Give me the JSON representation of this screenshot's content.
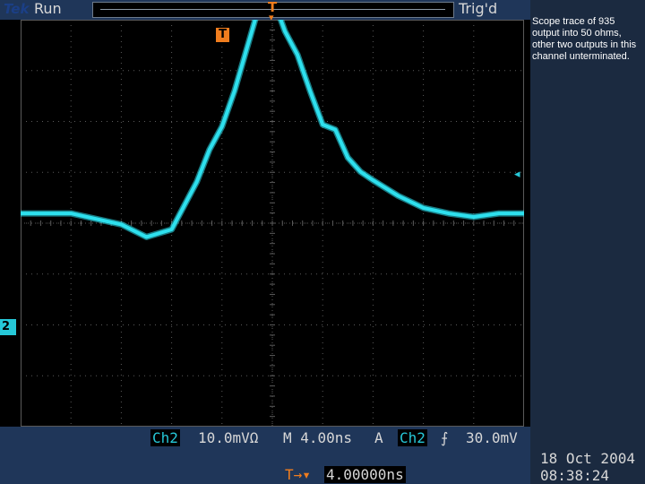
{
  "header": {
    "brand": "Tek",
    "run_status": "Run",
    "trigger_status": "Trig'd"
  },
  "markers": {
    "trigger_position": "T",
    "trigger_on_screen": "T",
    "channel_ground": "2",
    "trigger_level": "◂"
  },
  "status": {
    "channel": "Ch2",
    "volts_per_div": "10.0mVΩ",
    "timebase": "M 4.00ns",
    "trigger_mode": "A",
    "trigger_channel": "Ch2",
    "trigger_slope_icon": "rising-edge-icon",
    "trigger_level": "30.0mV",
    "trigger_delay_label": "T→▾",
    "trigger_delay": "4.00000ns",
    "date": "18 Oct  2004",
    "time": "08:38:24"
  },
  "annotation": "Scope trace of 935 output into 50 ohms, other two outputs in this channel unterminated.",
  "colors": {
    "trace": "#2ee0ee",
    "trigger_marker": "#f07d1e",
    "graticule": "#5a5a5a",
    "panel": "#1f3659"
  },
  "chart_data": {
    "type": "line",
    "title": "",
    "xlabel": "",
    "ylabel": "",
    "x_units": "ns",
    "y_units": "mV",
    "x": [
      -20,
      -16,
      -12,
      -10,
      -8,
      -6,
      -5,
      -4,
      -3,
      -2,
      -1,
      0,
      1,
      2,
      3,
      4,
      5,
      6,
      7,
      8,
      10,
      12,
      14,
      16,
      18,
      20
    ],
    "y": [
      0,
      0,
      -2.2,
      -4.7,
      -3.2,
      6.3,
      12.7,
      17.3,
      24.4,
      33.1,
      41.7,
      43.2,
      36.3,
      31.6,
      24.4,
      17.7,
      16.7,
      11.1,
      8.3,
      6.6,
      3.5,
      1.1,
      0,
      -0.7,
      0,
      0
    ],
    "xlim": [
      -20,
      20
    ],
    "ylim": [
      -42.5,
      38.6
    ],
    "grid": true
  }
}
